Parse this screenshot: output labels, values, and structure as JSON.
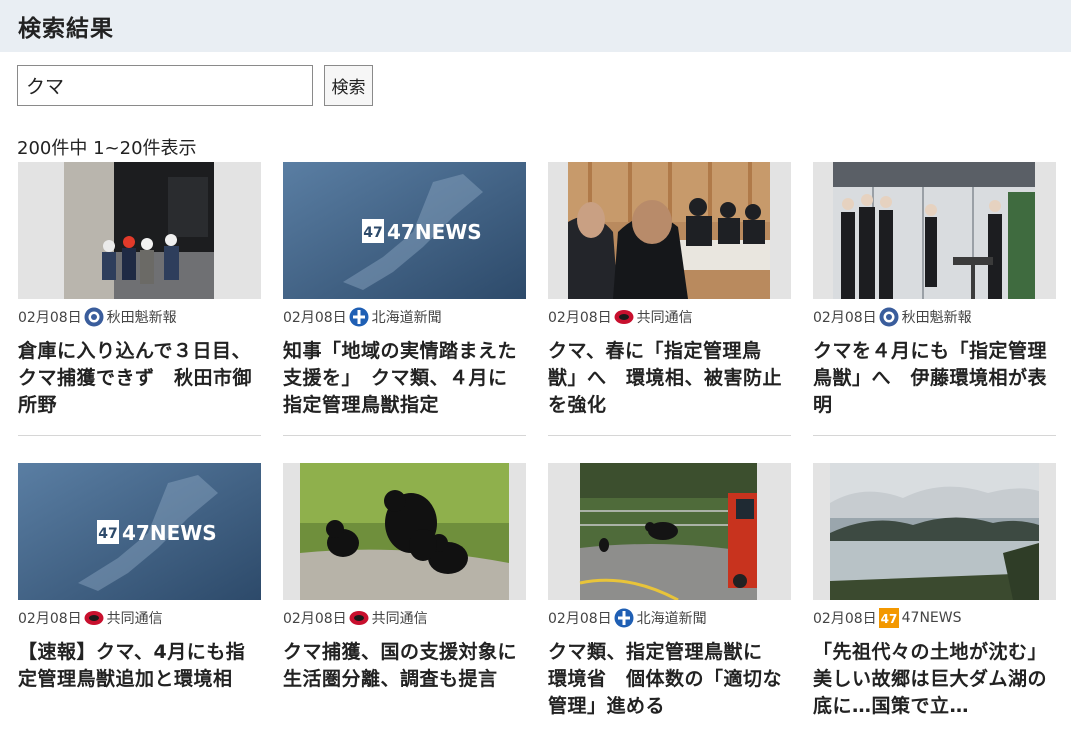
{
  "header": {
    "title": "検索結果"
  },
  "search": {
    "value": "クマ",
    "button_label": "検索"
  },
  "results_info": "200件中 1~20件表示",
  "articles": [
    {
      "date": "02月08日",
      "source": "秋田魁新報",
      "title": "倉庫に入り込んで３日目、クマ捕獲できず　秋田市御所野"
    },
    {
      "date": "02月08日",
      "source": "北海道新聞",
      "title": "知事「地域の実情踏まえた支援を」　クマ類、４月に指定管理鳥獣指定"
    },
    {
      "date": "02月08日",
      "source": "共同通信",
      "title": "クマ、春に「指定管理鳥獣」へ　環境相、被害防止を強化"
    },
    {
      "date": "02月08日",
      "source": "秋田魁新報",
      "title": "クマを４月にも「指定管理鳥獣」へ　伊藤環境相が表明"
    },
    {
      "date": "02月08日",
      "source": "共同通信",
      "title": "【速報】クマ、4月にも指定管理鳥獣追加と環境相"
    },
    {
      "date": "02月08日",
      "source": "共同通信",
      "title": "クマ捕獲、国の支援対象に　生活圏分離、調査も提言"
    },
    {
      "date": "02月08日",
      "source": "北海道新聞",
      "title": "クマ類、指定管理鳥獣に　環境省　個体数の「適切な管理」進める"
    },
    {
      "date": "02月08日",
      "source": "47NEWS",
      "title": "「先祖代々の土地が沈む」美しい故郷は巨大ダム湖の底に…国策で立…"
    }
  ],
  "logo_text": {
    "news47": "47NEWS",
    "badge47": "47"
  },
  "colors": {
    "header_bg": "#e9eef3",
    "kyodo_red": "#c8102e",
    "hokkaido_blue": "#1f5fb4",
    "sakigake_blue": "#3a5d9c",
    "news47_orange": "#f39800"
  }
}
